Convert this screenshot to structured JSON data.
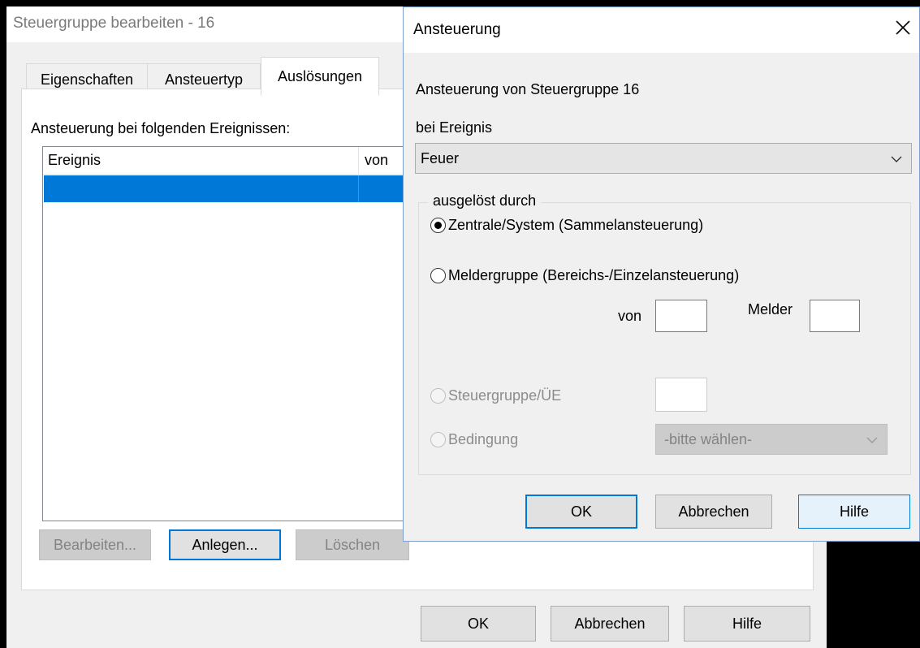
{
  "background_window": {
    "title": "Steuergruppe bearbeiten  - 16",
    "tabs": [
      {
        "label": "Eigenschaften",
        "active": false
      },
      {
        "label": "Ansteuertyp",
        "active": false
      },
      {
        "label": "Auslösungen",
        "active": true
      }
    ],
    "list_label": "Ansteuerung bei folgenden Ereignissen:",
    "list_columns": [
      "Ereignis",
      "von"
    ],
    "buttons": {
      "bearbeiten": "Bearbeiten...",
      "anlegen": "Anlegen...",
      "loeschen": "Löschen"
    },
    "footer_buttons": {
      "ok": "OK",
      "abbrechen": "Abbrechen",
      "hilfe": "Hilfe"
    }
  },
  "dialog": {
    "title": "Ansteuerung",
    "heading": "Ansteuerung von Steuergruppe 16",
    "event_label": "bei Ereignis",
    "event_value": "Feuer",
    "group_label": "ausgelöst durch",
    "options": {
      "zentrale": "Zentrale/System (Sammelansteuerung)",
      "meldergruppe": "Meldergruppe (Bereichs-/Einzelansteuerung)",
      "steuergruppe": "Steuergruppe/ÜE",
      "bedingung": "Bedingung"
    },
    "selected_option": "zentrale",
    "von_label": "von",
    "melder_label": "Melder",
    "bedingung_placeholder": "-bitte wählen-",
    "buttons": {
      "ok": "OK",
      "abbrechen": "Abbrechen",
      "hilfe": "Hilfe"
    }
  },
  "colors": {
    "selection": "#0078d7",
    "window_bg": "#f0f0f0",
    "disabled_text": "#838383"
  }
}
